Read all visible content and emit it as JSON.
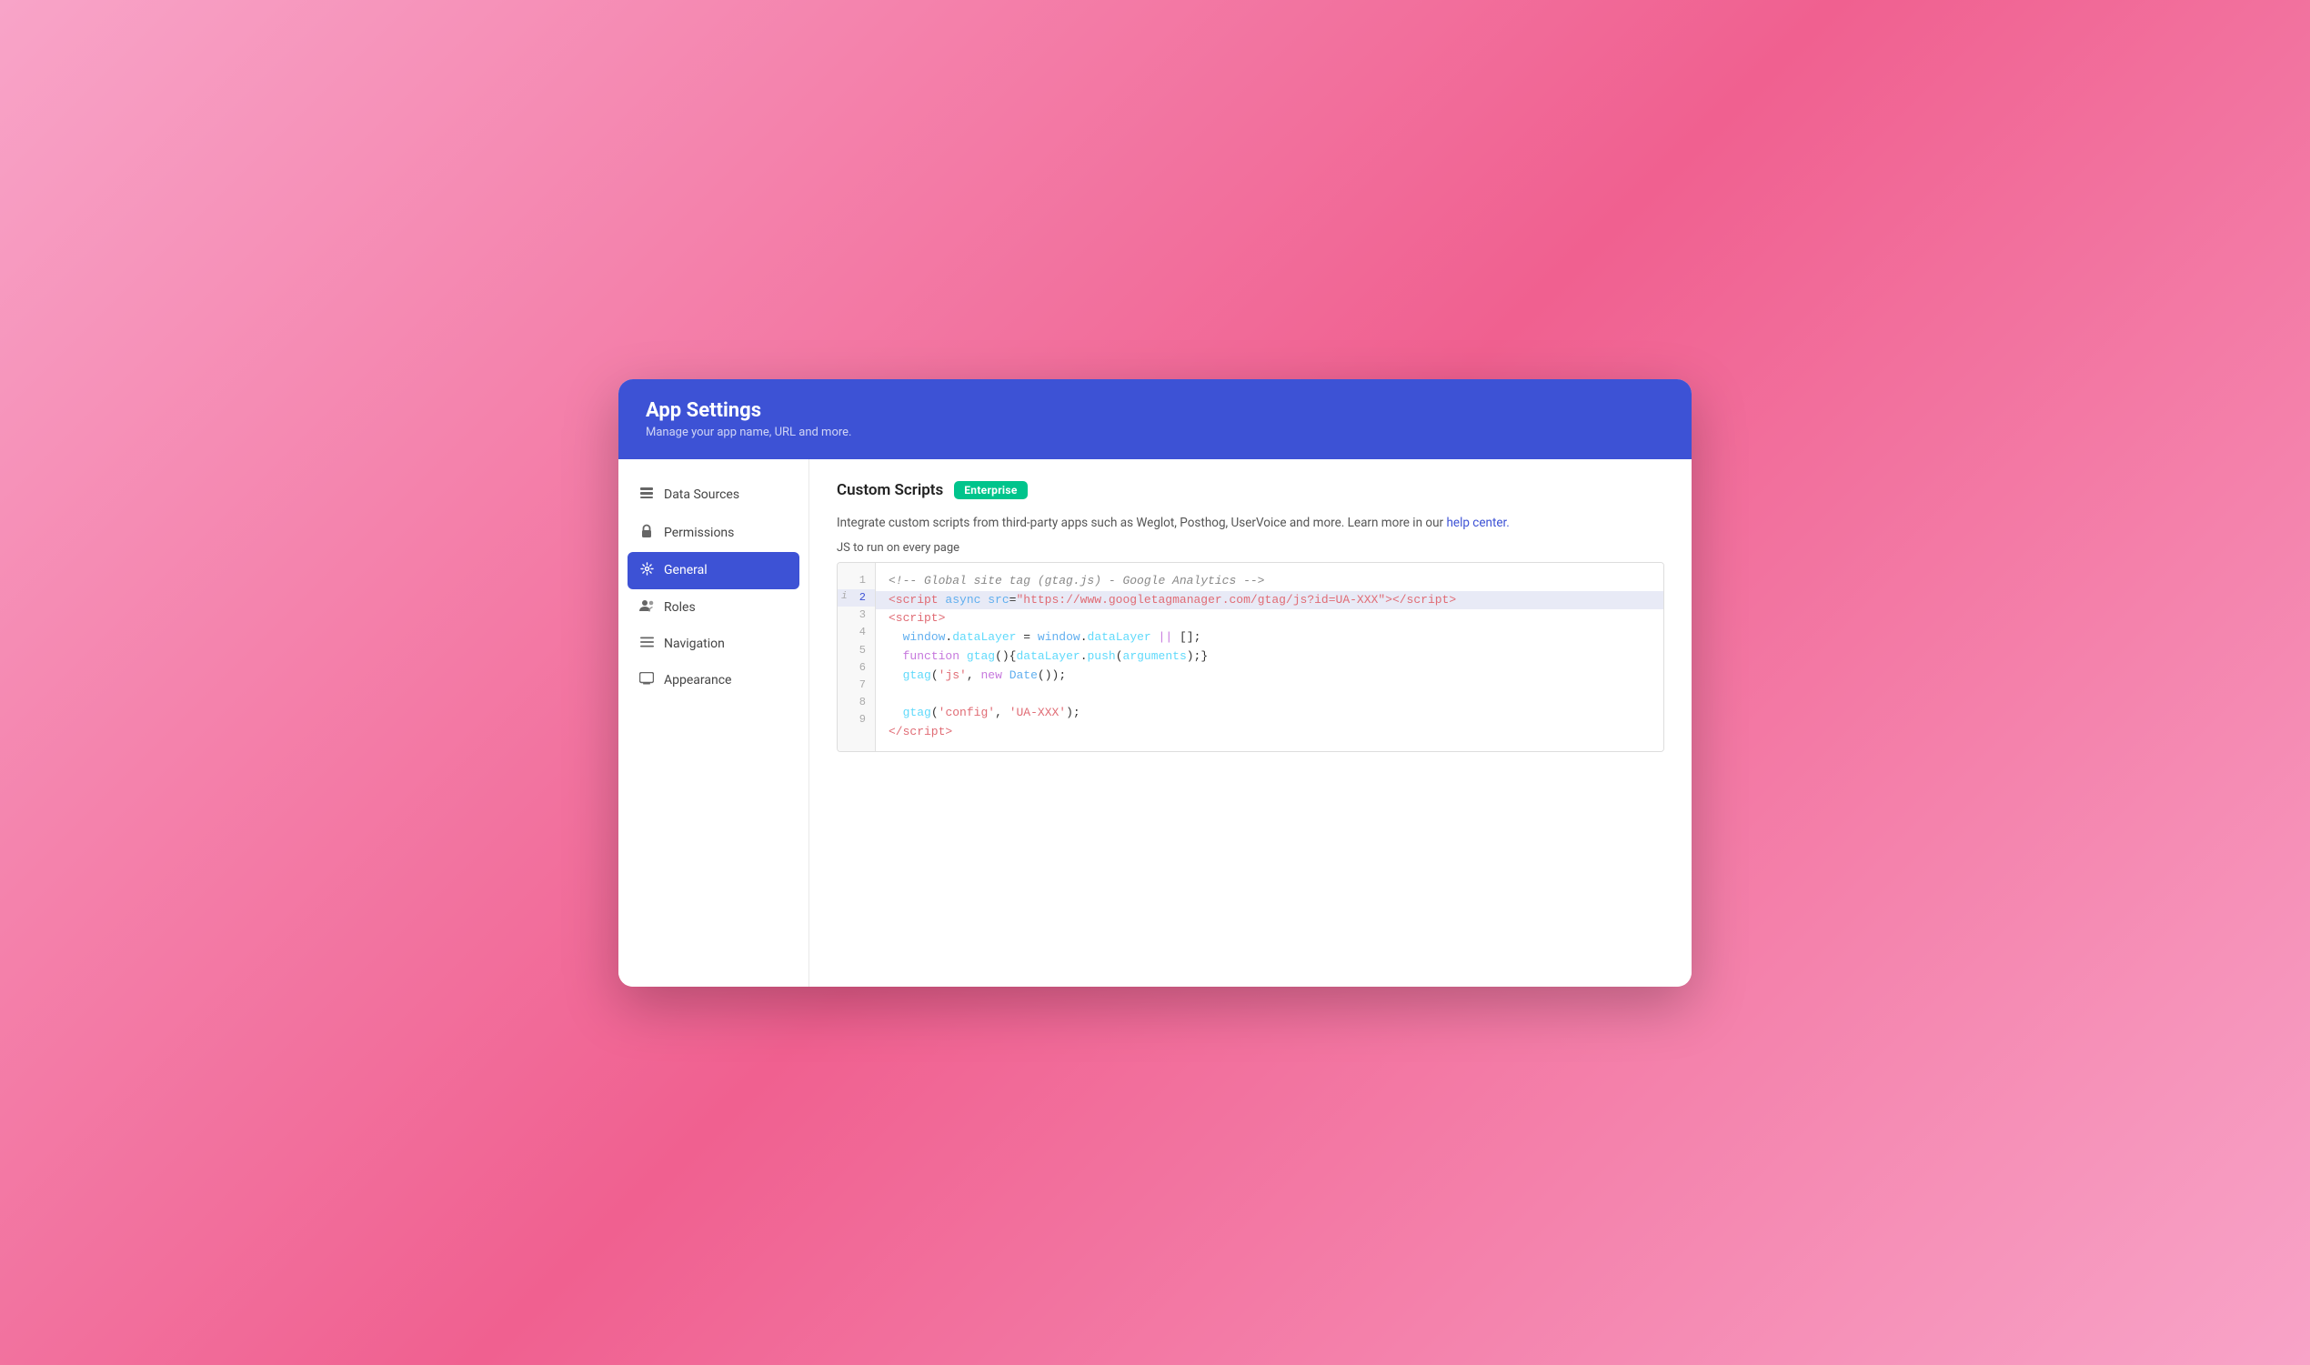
{
  "header": {
    "title": "App Settings",
    "subtitle": "Manage your app name, URL and more."
  },
  "sidebar": {
    "items": [
      {
        "id": "data-sources",
        "label": "Data Sources",
        "icon": "☰"
      },
      {
        "id": "permissions",
        "label": "Permissions",
        "icon": "🔒"
      },
      {
        "id": "general",
        "label": "General",
        "icon": "⚙",
        "active": true
      },
      {
        "id": "roles",
        "label": "Roles",
        "icon": "👥"
      },
      {
        "id": "navigation",
        "label": "Navigation",
        "icon": "☰"
      },
      {
        "id": "appearance",
        "label": "Appearance",
        "icon": "🖥"
      }
    ]
  },
  "main": {
    "section_title": "Custom Scripts",
    "badge_label": "Enterprise",
    "description": "Integrate custom scripts from third-party apps such as Weglot, Posthog, UserVoice and more. Learn more in our",
    "help_link_text": "help center.",
    "code_label": "JS to run on every page",
    "code_lines": [
      {
        "num": 1,
        "content": "<!-- Global site tag (gtag.js) - Google Analytics -->"
      },
      {
        "num": 2,
        "content": "<script async src=\"https://www.googletagmanager.com/gtag/js?id=UA-XXX\"><\\/script>",
        "highlight": true
      },
      {
        "num": 3,
        "content": "<script>"
      },
      {
        "num": 4,
        "content": "  window.dataLayer = window.dataLayer || [];"
      },
      {
        "num": 5,
        "content": "  function gtag(){dataLayer.push(arguments);}"
      },
      {
        "num": 6,
        "content": "  gtag('js', new Date());"
      },
      {
        "num": 7,
        "content": ""
      },
      {
        "num": 8,
        "content": "  gtag('config', 'UA-XXX');"
      },
      {
        "num": 9,
        "content": "<\\/script>"
      }
    ]
  }
}
